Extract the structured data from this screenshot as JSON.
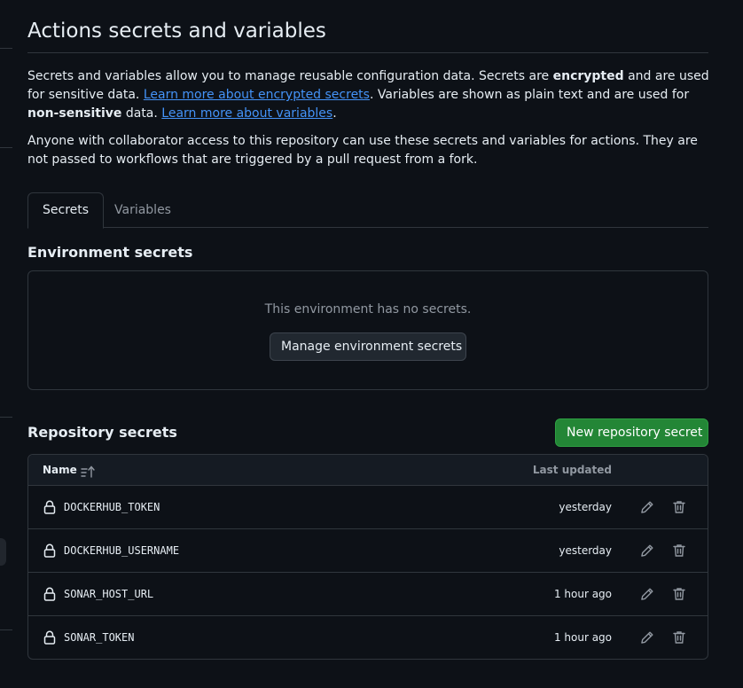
{
  "page": {
    "title": "Actions secrets and variables",
    "intro": {
      "p1_a": "Secrets and variables allow you to manage reusable configuration data. Secrets are ",
      "p1_b": "encrypted",
      "p1_c": " and are used for sensitive data. ",
      "link_secrets": "Learn more about encrypted secrets",
      "p1_d": ". Variables are shown as plain text and are used for ",
      "p1_e": "non-sensitive",
      "p1_f": " data. ",
      "link_variables": "Learn more about variables",
      "p1_g": ".",
      "p2": "Anyone with collaborator access to this repository can use these secrets and variables for actions. They are not passed to workflows that are triggered by a pull request from a fork."
    }
  },
  "tabs": [
    {
      "label": "Secrets",
      "active": true
    },
    {
      "label": "Variables",
      "active": false
    }
  ],
  "environment": {
    "heading": "Environment secrets",
    "empty_text": "This environment has no secrets.",
    "manage_button": "Manage environment secrets"
  },
  "repository": {
    "heading": "Repository secrets",
    "new_button": "New repository secret",
    "columns": {
      "name": "Name",
      "updated": "Last updated"
    },
    "secrets": [
      {
        "name": "DOCKERHUB_TOKEN",
        "updated": "yesterday"
      },
      {
        "name": "DOCKERHUB_USERNAME",
        "updated": "yesterday"
      },
      {
        "name": "SONAR_HOST_URL",
        "updated": "1 hour ago"
      },
      {
        "name": "SONAR_TOKEN",
        "updated": "1 hour ago"
      }
    ]
  },
  "colors": {
    "background": "#0d1117",
    "border": "#30363d",
    "link": "#4493f8",
    "primary_button": "#238636",
    "muted_text": "#9198a1"
  },
  "icons": {
    "sort": "sort-ascending-icon",
    "lock": "lock-icon",
    "edit": "pencil-icon",
    "delete": "trash-icon"
  }
}
